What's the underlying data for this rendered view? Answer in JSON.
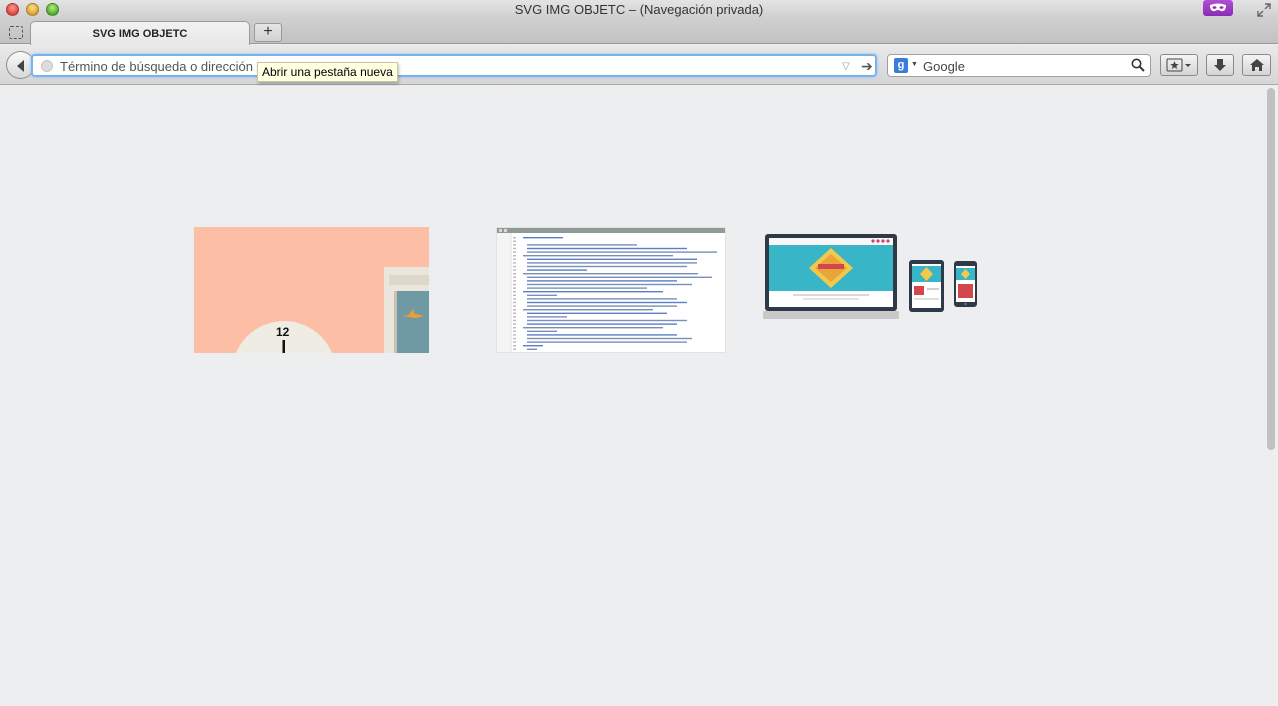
{
  "window": {
    "title": "SVG IMG OBJETC – (Navegación privada)"
  },
  "tabs": [
    {
      "label": "SVG IMG OBJETC"
    }
  ],
  "new_tab_label": "+",
  "urlbar": {
    "placeholder": "Término de búsqueda o dirección"
  },
  "searchbar": {
    "engine_letter": "g",
    "placeholder": "Google"
  },
  "tooltip": {
    "text": "Abrir una pestaña nueva"
  },
  "content": {
    "clock_label": "12"
  },
  "icons": {
    "back": "back-arrow-icon",
    "globe": "globe-icon",
    "go": "go-arrow-icon",
    "search": "magnifier-icon",
    "bookmark": "bookmark-star-icon",
    "download": "download-arrow-icon",
    "home": "home-icon",
    "private": "private-mask-icon"
  },
  "colors": {
    "url_focus": "#7ab2ec",
    "private_badge": "#9b3cc6",
    "object1_bg": "#fdbea6",
    "object3_screen": "#38b6c8"
  }
}
